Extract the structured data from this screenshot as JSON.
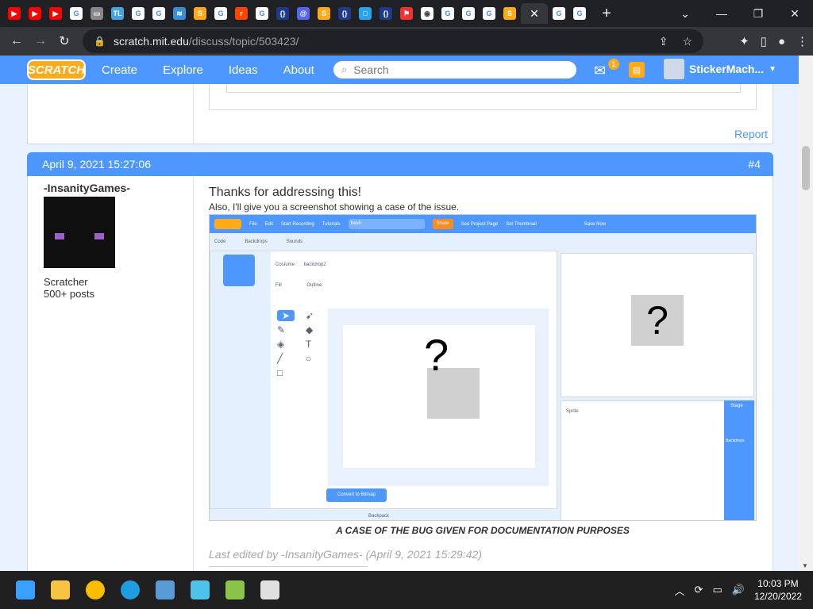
{
  "browser": {
    "active_tab_close": "✕",
    "new_tab": "+",
    "url_host": "scratch.mit.edu",
    "url_path": "/discuss/topic/503423/",
    "colors": {
      "tabbar": "#202124",
      "toolbar": "#35363a"
    }
  },
  "scratch_nav": {
    "logo": "SCRATCH",
    "links": [
      "Create",
      "Explore",
      "Ideas",
      "About"
    ],
    "search_placeholder": "Search",
    "messages_count": "1",
    "username": "StickerMach...",
    "accent": "#4d97ff"
  },
  "prev_post": {
    "report_label": "Report"
  },
  "post": {
    "date": "April 9, 2021 15:27:06",
    "number": "#4",
    "author": "-InsanityGames-",
    "rank": "Scratcher",
    "post_count": "500+ posts",
    "line1": "Thanks for addressing this!",
    "line2": "Also, I'll give you a screenshot showing a case of the issue.",
    "caption": "A CASE OF THE BUG GIVEN FOR DOCUMENTATION PURPOSES",
    "last_edited": "Last edited by -InsanityGames- (April 9, 2021 15:29:42)"
  },
  "embedded_screenshot": {
    "menu_items": [
      "File",
      "Edit",
      "Start Recording",
      "Tutorials"
    ],
    "project_title": "fresh",
    "share_label": "Share",
    "see_project_page": "See Project Page",
    "set_thumbnail": "Set Thumbnail",
    "save_now": "Save Now",
    "tabs": [
      "Code",
      "Backdrops",
      "Sounds"
    ],
    "costume_label": "Costume",
    "costume_name": "backdrop2",
    "fill_label": "Fill",
    "outline_label": "Outline",
    "convert_label": "Convert to Bitmap",
    "backpack_label": "Backpack",
    "stage_label": "Stage",
    "backdrops_label": "Backdrops",
    "sprite_label": "Sprite",
    "qmark": "?"
  },
  "taskbar": {
    "time": "10:03 PM",
    "date": "12/20/2022"
  }
}
